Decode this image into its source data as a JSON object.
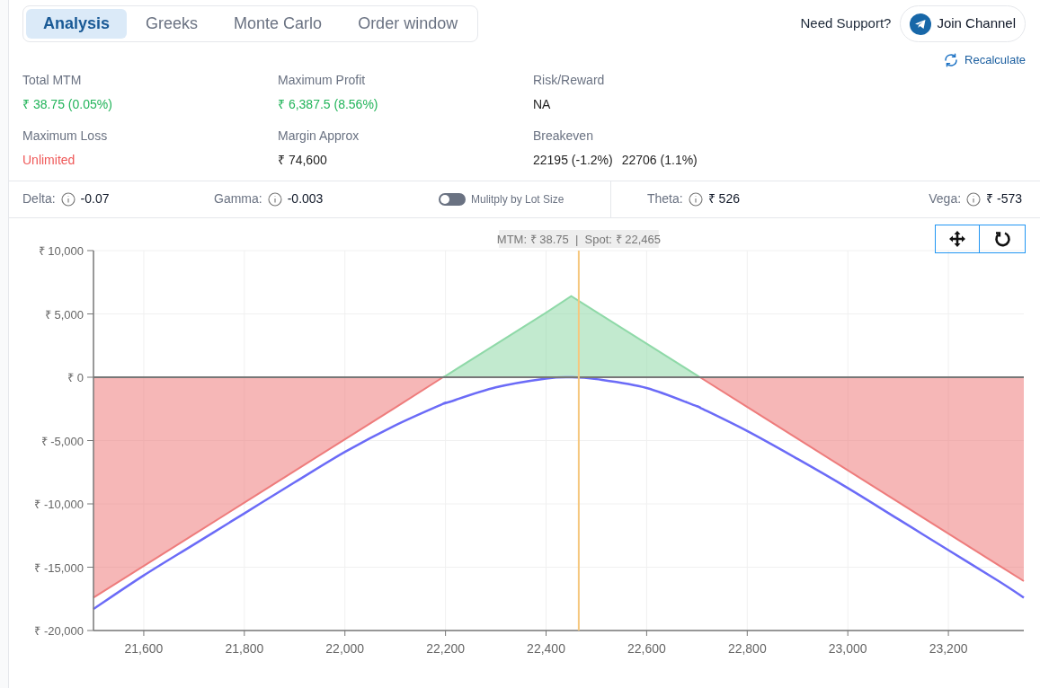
{
  "tabs": [
    {
      "label": "Analysis",
      "selected": true
    },
    {
      "label": "Greeks",
      "selected": false
    },
    {
      "label": "Monte Carlo",
      "selected": false
    },
    {
      "label": "Order window",
      "selected": false
    }
  ],
  "support": {
    "prompt": "Need Support?",
    "button": "Join Channel"
  },
  "recalculate": "Recalculate",
  "stats": [
    {
      "label": "Total MTM",
      "values": [
        "₹ 38.75 (0.05%)"
      ],
      "color": "#22b45a"
    },
    {
      "label": "Maximum Profit",
      "values": [
        "₹ 6,387.5 (8.56%)"
      ],
      "color": "#22b45a"
    },
    {
      "label": "Risk/Reward",
      "values": [
        "NA"
      ],
      "color": "#1f1f1f"
    },
    {
      "label": "Maximum Loss",
      "values": [
        "Unlimited"
      ],
      "color": "#ef5858"
    },
    {
      "label": "Margin Approx",
      "values": [
        "₹ 74,600"
      ],
      "color": "#1f1f1f"
    },
    {
      "label": "Breakeven",
      "values": [
        "22195 (-1.2%)",
        "22706 (1.1%)"
      ],
      "color": "#1f1f1f"
    }
  ],
  "greeks": [
    {
      "kind": "metric",
      "label": "Delta:",
      "value": "-0.07"
    },
    {
      "kind": "metric",
      "label": "Gamma:",
      "value": "-0.003"
    },
    {
      "kind": "toggle",
      "label": "Mulitply by Lot Size",
      "on": false
    },
    {
      "kind": "metric",
      "label": "Theta:",
      "value": "₹ 526"
    },
    {
      "kind": "metric",
      "label": "Vega:",
      "value": "₹ -573"
    }
  ],
  "chart": {
    "chart_data": {
      "type": "area",
      "grid": true,
      "x": [
        21500,
        21600,
        21700,
        21800,
        21900,
        22000,
        22100,
        22195,
        22200,
        22300,
        22400,
        22450,
        22500,
        22600,
        22700,
        22706,
        22800,
        22900,
        23000,
        23100,
        23200,
        23300,
        23350
      ],
      "series": [
        {
          "color": "#ee7c7c",
          "values": [
            -17400,
            -14900,
            -12400,
            -9900,
            -7400,
            -4900,
            -2400,
            0,
            null,
            null,
            null,
            null,
            null,
            null,
            null,
            0,
            -2350,
            -4850,
            -7350,
            -9850,
            -12350,
            -14850,
            -16100
          ]
        },
        {
          "color": "#8fd9a8",
          "values": [
            null,
            null,
            null,
            null,
            null,
            null,
            null,
            0,
            100,
            2600,
            5100,
            6400,
            5150,
            2650,
            150,
            0,
            null,
            null,
            null,
            null,
            null,
            null,
            null
          ]
        },
        {
          "type": "line",
          "color": "#6b6bf7",
          "values": [
            -18300,
            -15650,
            -13200,
            -10750,
            -8300,
            -5900,
            -3800,
            -2100,
            -2050,
            -800,
            -100,
            0,
            -150,
            -850,
            -2300,
            -2400,
            -4250,
            -6450,
            -8750,
            -11200,
            -13650,
            -16100,
            -17400
          ]
        }
      ],
      "xlim": [
        21500,
        23350
      ],
      "ylim": [
        -20000,
        10000
      ],
      "xticks": [
        {
          "value": 21600,
          "label": "21,600"
        },
        {
          "value": 21800,
          "label": "21,800"
        },
        {
          "value": 22000,
          "label": "22,000"
        },
        {
          "value": 22200,
          "label": "22,200"
        },
        {
          "value": 22400,
          "label": "22,400"
        },
        {
          "value": 22600,
          "label": "22,600"
        },
        {
          "value": 22800,
          "label": "22,800"
        },
        {
          "value": 23000,
          "label": "23,000"
        },
        {
          "value": 23200,
          "label": "23,200"
        }
      ],
      "yticks": [
        {
          "value": 10000,
          "label": "₹ 10,000"
        },
        {
          "value": 5000,
          "label": "₹ 5,000"
        },
        {
          "value": 0,
          "label": "₹ 0"
        },
        {
          "value": -5000,
          "label": "₹ -5,000"
        },
        {
          "value": -10000,
          "label": "₹ -10,000"
        },
        {
          "value": -15000,
          "label": "₹ -15,000"
        },
        {
          "value": -20000,
          "label": "₹ -20,000"
        }
      ],
      "ref_lines": [
        {
          "axis": "y",
          "value": 0
        },
        {
          "axis": "x",
          "value": 22465,
          "label": "MTM: ₹ 38.75  |  Spot: ₹ 22,465"
        }
      ]
    }
  }
}
